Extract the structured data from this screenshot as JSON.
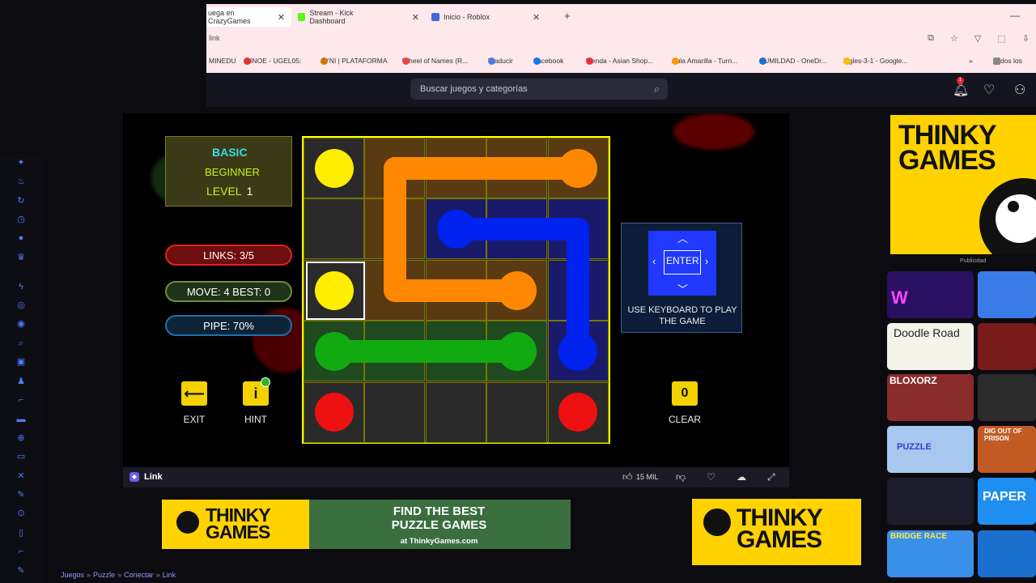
{
  "browser": {
    "tabs": [
      {
        "label": "uega en CrazyGames",
        "active": true
      },
      {
        "label": "Stream - Kick Dashboard"
      },
      {
        "label": "Inicio - Roblox"
      }
    ],
    "url": "link",
    "bookmarks": [
      "MINEDU",
      ":SINOE - UGEL05:",
      "AYNI | PLATAFORMA",
      "Wheel of Names (R...",
      "Traducir",
      "Facebook",
      "Tienda - Asian Shop...",
      "Aula Amarilla - Turn...",
      "HUMILDAD - OneDr...",
      "ingles-3-1 - Google...",
      "Todos los"
    ]
  },
  "header": {
    "search_placeholder": "Buscar juegos y categorías",
    "notif_count": "1"
  },
  "game": {
    "level_panel": {
      "mode": "BASIC",
      "difficulty": "BEGINNER",
      "level_label": "LEVEL",
      "level_num": "1"
    },
    "links": "LINKS:  3/5",
    "move_best": "MOVE: 4    BEST: 0",
    "pipe": "PIPE:  70%",
    "exit_label": "EXIT",
    "hint_label": "HINT",
    "clear_label": "CLEAR",
    "clear_count": "0",
    "enter_label": "ENTER",
    "keyboard_text": "USE KEYBOARD TO PLAY THE GAME",
    "colors": {
      "yellow": "#ffee00",
      "orange": "#ff8800",
      "blue": "#0022ee",
      "green": "#11aa11",
      "red": "#ee1111"
    }
  },
  "gamebar": {
    "title": "Link",
    "likes": "15 MIL"
  },
  "ads": {
    "brand": "THINKY GAMES",
    "find_text": "FIND THE BEST PUZZLE GAMES",
    "find_sub": "at ThinkyGames.com",
    "publicidad": "Publicidad"
  },
  "thumbs": [
    "Doodle Road",
    "BLOXORZ",
    "PUZZLE",
    "DIG OUT OF PRISON",
    "BRIDGE RACE",
    "PAPER"
  ],
  "breadcrumb": [
    "Juegos",
    "Puzzle",
    "Conectar",
    "Link"
  ]
}
